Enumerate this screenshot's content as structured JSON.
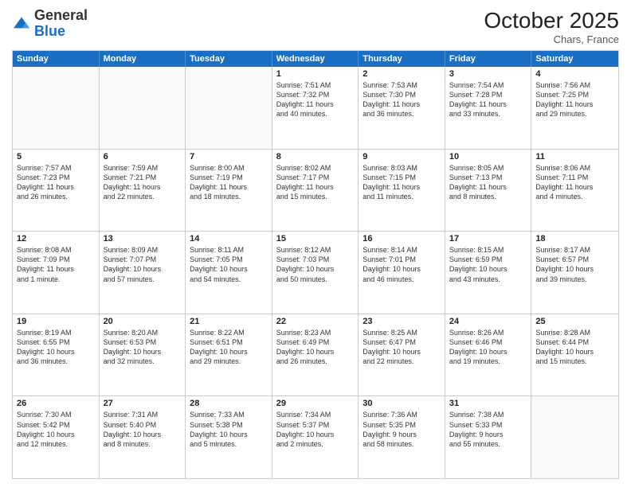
{
  "header": {
    "logo_general": "General",
    "logo_blue": "Blue",
    "month_title": "October 2025",
    "location": "Chars, France"
  },
  "days_of_week": [
    "Sunday",
    "Monday",
    "Tuesday",
    "Wednesday",
    "Thursday",
    "Friday",
    "Saturday"
  ],
  "rows": [
    [
      {
        "day": "",
        "lines": [],
        "empty": true
      },
      {
        "day": "",
        "lines": [],
        "empty": true
      },
      {
        "day": "",
        "lines": [],
        "empty": true
      },
      {
        "day": "1",
        "lines": [
          "Sunrise: 7:51 AM",
          "Sunset: 7:32 PM",
          "Daylight: 11 hours",
          "and 40 minutes."
        ]
      },
      {
        "day": "2",
        "lines": [
          "Sunrise: 7:53 AM",
          "Sunset: 7:30 PM",
          "Daylight: 11 hours",
          "and 36 minutes."
        ]
      },
      {
        "day": "3",
        "lines": [
          "Sunrise: 7:54 AM",
          "Sunset: 7:28 PM",
          "Daylight: 11 hours",
          "and 33 minutes."
        ]
      },
      {
        "day": "4",
        "lines": [
          "Sunrise: 7:56 AM",
          "Sunset: 7:25 PM",
          "Daylight: 11 hours",
          "and 29 minutes."
        ]
      }
    ],
    [
      {
        "day": "5",
        "lines": [
          "Sunrise: 7:57 AM",
          "Sunset: 7:23 PM",
          "Daylight: 11 hours",
          "and 26 minutes."
        ]
      },
      {
        "day": "6",
        "lines": [
          "Sunrise: 7:59 AM",
          "Sunset: 7:21 PM",
          "Daylight: 11 hours",
          "and 22 minutes."
        ]
      },
      {
        "day": "7",
        "lines": [
          "Sunrise: 8:00 AM",
          "Sunset: 7:19 PM",
          "Daylight: 11 hours",
          "and 18 minutes."
        ]
      },
      {
        "day": "8",
        "lines": [
          "Sunrise: 8:02 AM",
          "Sunset: 7:17 PM",
          "Daylight: 11 hours",
          "and 15 minutes."
        ]
      },
      {
        "day": "9",
        "lines": [
          "Sunrise: 8:03 AM",
          "Sunset: 7:15 PM",
          "Daylight: 11 hours",
          "and 11 minutes."
        ]
      },
      {
        "day": "10",
        "lines": [
          "Sunrise: 8:05 AM",
          "Sunset: 7:13 PM",
          "Daylight: 11 hours",
          "and 8 minutes."
        ]
      },
      {
        "day": "11",
        "lines": [
          "Sunrise: 8:06 AM",
          "Sunset: 7:11 PM",
          "Daylight: 11 hours",
          "and 4 minutes."
        ]
      }
    ],
    [
      {
        "day": "12",
        "lines": [
          "Sunrise: 8:08 AM",
          "Sunset: 7:09 PM",
          "Daylight: 11 hours",
          "and 1 minute."
        ]
      },
      {
        "day": "13",
        "lines": [
          "Sunrise: 8:09 AM",
          "Sunset: 7:07 PM",
          "Daylight: 10 hours",
          "and 57 minutes."
        ]
      },
      {
        "day": "14",
        "lines": [
          "Sunrise: 8:11 AM",
          "Sunset: 7:05 PM",
          "Daylight: 10 hours",
          "and 54 minutes."
        ]
      },
      {
        "day": "15",
        "lines": [
          "Sunrise: 8:12 AM",
          "Sunset: 7:03 PM",
          "Daylight: 10 hours",
          "and 50 minutes."
        ]
      },
      {
        "day": "16",
        "lines": [
          "Sunrise: 8:14 AM",
          "Sunset: 7:01 PM",
          "Daylight: 10 hours",
          "and 46 minutes."
        ]
      },
      {
        "day": "17",
        "lines": [
          "Sunrise: 8:15 AM",
          "Sunset: 6:59 PM",
          "Daylight: 10 hours",
          "and 43 minutes."
        ]
      },
      {
        "day": "18",
        "lines": [
          "Sunrise: 8:17 AM",
          "Sunset: 6:57 PM",
          "Daylight: 10 hours",
          "and 39 minutes."
        ]
      }
    ],
    [
      {
        "day": "19",
        "lines": [
          "Sunrise: 8:19 AM",
          "Sunset: 6:55 PM",
          "Daylight: 10 hours",
          "and 36 minutes."
        ]
      },
      {
        "day": "20",
        "lines": [
          "Sunrise: 8:20 AM",
          "Sunset: 6:53 PM",
          "Daylight: 10 hours",
          "and 32 minutes."
        ]
      },
      {
        "day": "21",
        "lines": [
          "Sunrise: 8:22 AM",
          "Sunset: 6:51 PM",
          "Daylight: 10 hours",
          "and 29 minutes."
        ]
      },
      {
        "day": "22",
        "lines": [
          "Sunrise: 8:23 AM",
          "Sunset: 6:49 PM",
          "Daylight: 10 hours",
          "and 26 minutes."
        ]
      },
      {
        "day": "23",
        "lines": [
          "Sunrise: 8:25 AM",
          "Sunset: 6:47 PM",
          "Daylight: 10 hours",
          "and 22 minutes."
        ]
      },
      {
        "day": "24",
        "lines": [
          "Sunrise: 8:26 AM",
          "Sunset: 6:46 PM",
          "Daylight: 10 hours",
          "and 19 minutes."
        ]
      },
      {
        "day": "25",
        "lines": [
          "Sunrise: 8:28 AM",
          "Sunset: 6:44 PM",
          "Daylight: 10 hours",
          "and 15 minutes."
        ]
      }
    ],
    [
      {
        "day": "26",
        "lines": [
          "Sunrise: 7:30 AM",
          "Sunset: 5:42 PM",
          "Daylight: 10 hours",
          "and 12 minutes."
        ]
      },
      {
        "day": "27",
        "lines": [
          "Sunrise: 7:31 AM",
          "Sunset: 5:40 PM",
          "Daylight: 10 hours",
          "and 8 minutes."
        ]
      },
      {
        "day": "28",
        "lines": [
          "Sunrise: 7:33 AM",
          "Sunset: 5:38 PM",
          "Daylight: 10 hours",
          "and 5 minutes."
        ]
      },
      {
        "day": "29",
        "lines": [
          "Sunrise: 7:34 AM",
          "Sunset: 5:37 PM",
          "Daylight: 10 hours",
          "and 2 minutes."
        ]
      },
      {
        "day": "30",
        "lines": [
          "Sunrise: 7:36 AM",
          "Sunset: 5:35 PM",
          "Daylight: 9 hours",
          "and 58 minutes."
        ]
      },
      {
        "day": "31",
        "lines": [
          "Sunrise: 7:38 AM",
          "Sunset: 5:33 PM",
          "Daylight: 9 hours",
          "and 55 minutes."
        ]
      },
      {
        "day": "",
        "lines": [],
        "empty": true
      }
    ]
  ]
}
